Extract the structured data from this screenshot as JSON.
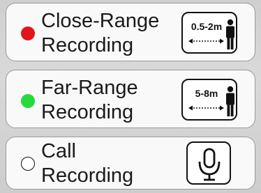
{
  "options": [
    {
      "label_line1": "Close-Range",
      "label_line2": "Recording",
      "range": "0.5-2m",
      "status_color": "#e0161c",
      "icon": "distance-person-icon",
      "selected_indicator": "red-dot"
    },
    {
      "label_line1": "Far-Range",
      "label_line2": "Recording",
      "range": "5-8m",
      "status_color": "#27d93b",
      "icon": "distance-person-icon",
      "selected_indicator": "green-dot"
    },
    {
      "label_line1": "Call",
      "label_line2": "Recording",
      "icon": "microphone-icon",
      "selected_indicator": "empty-radio"
    }
  ]
}
